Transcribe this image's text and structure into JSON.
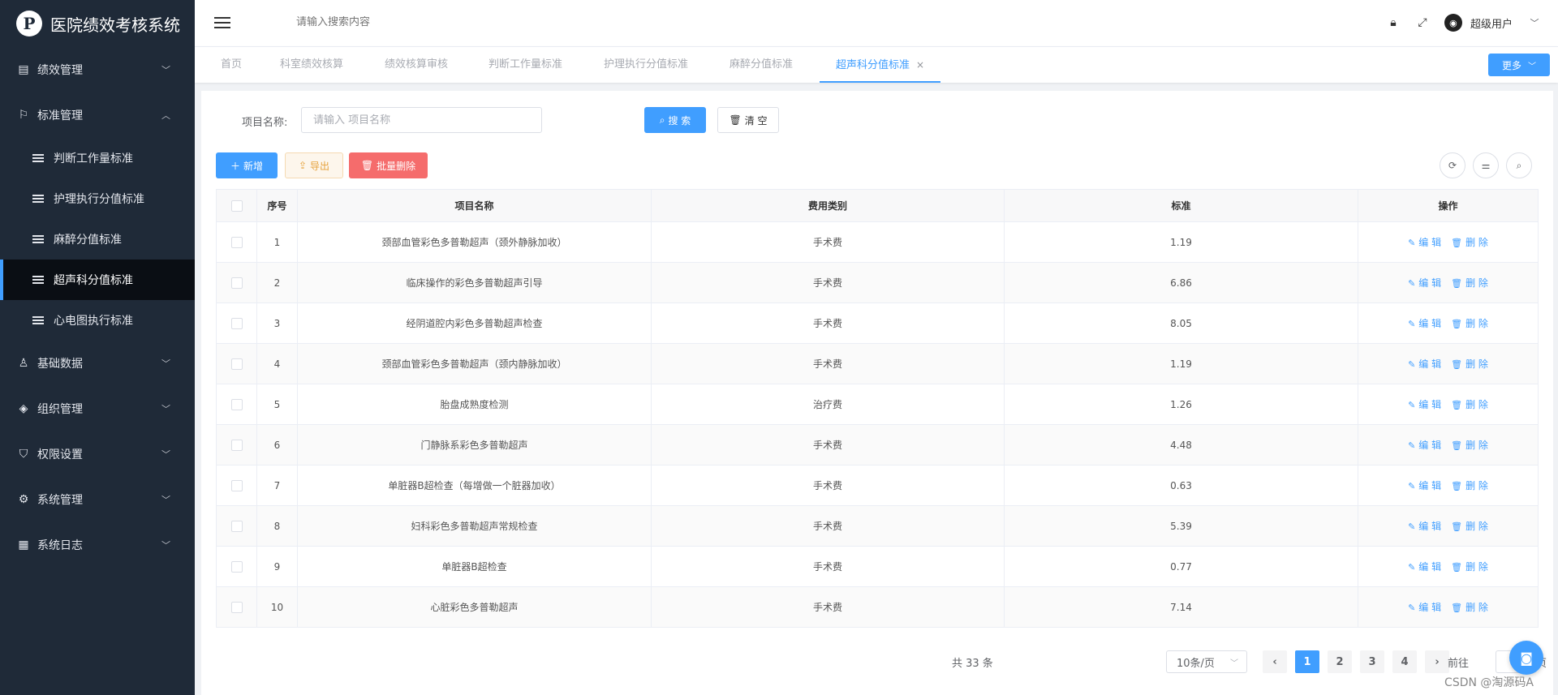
{
  "app": {
    "title": "医院绩效考核系统",
    "logo_letter": "P"
  },
  "sidebar": {
    "groups": [
      {
        "icon": "doc-icon",
        "label": "绩效管理",
        "expanded": false
      },
      {
        "icon": "flag-icon",
        "label": "标准管理",
        "expanded": true
      }
    ],
    "sub_items": [
      {
        "label": "判断工作量标准",
        "active": false
      },
      {
        "label": "护理执行分值标准",
        "active": false
      },
      {
        "label": "麻醉分值标准",
        "active": false
      },
      {
        "label": "超声科分值标准",
        "active": true
      },
      {
        "label": "心电图执行标准",
        "active": false
      }
    ],
    "more_groups": [
      {
        "icon": "user-icon",
        "label": "基础数据"
      },
      {
        "icon": "tag-icon",
        "label": "组织管理"
      },
      {
        "icon": "shield-icon",
        "label": "权限设置"
      },
      {
        "icon": "gear-icon",
        "label": "系统管理"
      },
      {
        "icon": "log-icon",
        "label": "系统日志"
      }
    ]
  },
  "header": {
    "search_placeholder": "请输入搜索内容",
    "user_name": "超级用户"
  },
  "tabs": [
    {
      "label": "首页"
    },
    {
      "label": "科室绩效核算"
    },
    {
      "label": "绩效核算审核"
    },
    {
      "label": "判断工作量标准"
    },
    {
      "label": "护理执行分值标准"
    },
    {
      "label": "麻醉分值标准"
    },
    {
      "label": "超声科分值标准",
      "active": true,
      "close": "×"
    }
  ],
  "more_label": "更多",
  "filter": {
    "label": "项目名称:",
    "placeholder": "请输入 项目名称",
    "search_btn": "搜 索",
    "clear_btn": "清 空"
  },
  "toolbar": {
    "add": "新增",
    "export": "导出",
    "batch_delete": "批量删除"
  },
  "table": {
    "columns": [
      "序号",
      "项目名称",
      "费用类别",
      "标准",
      "操作"
    ],
    "edit_label": "编 辑",
    "delete_label": "删 除",
    "rows": [
      {
        "no": "1",
        "name": "颈部血管彩色多普勒超声（颈外静脉加收）",
        "category": "手术费",
        "standard": "1.19"
      },
      {
        "no": "2",
        "name": "临床操作的彩色多普勒超声引导",
        "category": "手术费",
        "standard": "6.86"
      },
      {
        "no": "3",
        "name": "经阴道腔内彩色多普勒超声检查",
        "category": "手术费",
        "standard": "8.05"
      },
      {
        "no": "4",
        "name": "颈部血管彩色多普勒超声（颈内静脉加收）",
        "category": "手术费",
        "standard": "1.19"
      },
      {
        "no": "5",
        "name": "胎盘成熟度检测",
        "category": "治疗费",
        "standard": "1.26"
      },
      {
        "no": "6",
        "name": "门静脉系彩色多普勒超声",
        "category": "手术费",
        "standard": "4.48"
      },
      {
        "no": "7",
        "name": "单脏器B超检查（每增做一个脏器加收）",
        "category": "手术费",
        "standard": "0.63"
      },
      {
        "no": "8",
        "name": "妇科彩色多普勒超声常规检查",
        "category": "手术费",
        "standard": "5.39"
      },
      {
        "no": "9",
        "name": "单脏器B超检查",
        "category": "手术费",
        "standard": "0.77"
      },
      {
        "no": "10",
        "name": "心脏彩色多普勒超声",
        "category": "手术费",
        "standard": "7.14"
      }
    ]
  },
  "pagination": {
    "total": "共 33 条",
    "page_size": "10条/页",
    "pages": [
      "1",
      "2",
      "3",
      "4"
    ],
    "current": "1",
    "goto_label": "前往",
    "page_unit": "页"
  },
  "watermark": "CSDN @淘源码A",
  "colors": {
    "primary": "#409eff",
    "sidebar": "#1f2a38",
    "danger": "#f56c6c",
    "warning": "#e6a23c"
  }
}
